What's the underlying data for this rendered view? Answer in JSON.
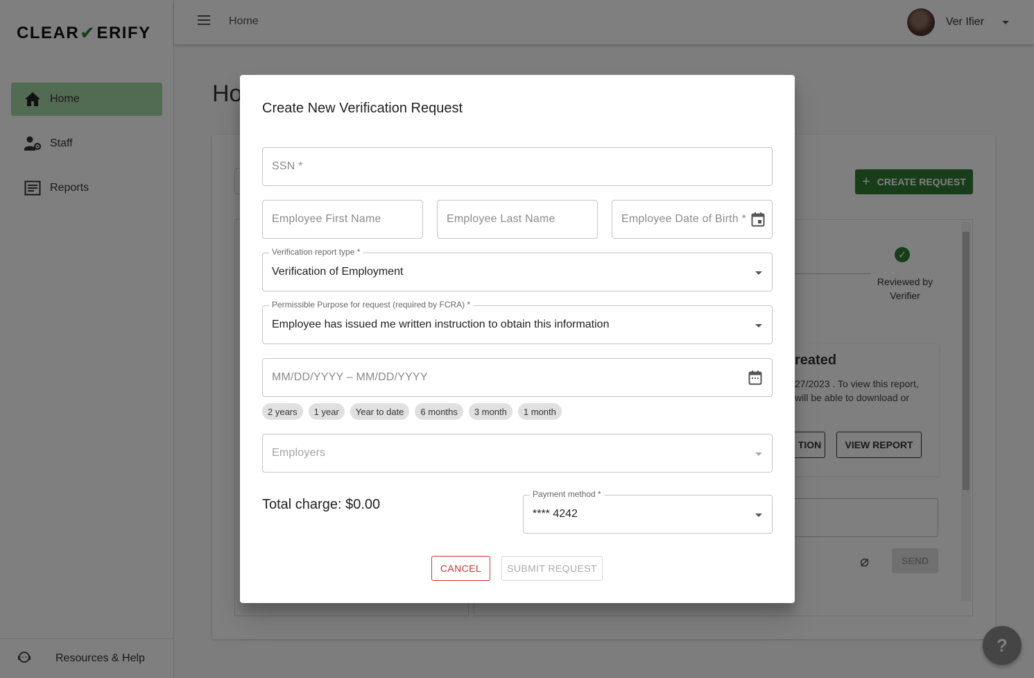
{
  "app": {
    "logo": {
      "part1": "CLEAR",
      "part2": "ERIFY"
    },
    "topbar": {
      "title": "Home",
      "user_name": "Ver Ifier"
    }
  },
  "sidebar": {
    "items": [
      {
        "label": "Home",
        "icon": "home-icon",
        "active": true
      },
      {
        "label": "Staff",
        "icon": "staff-settings-icon",
        "active": false
      },
      {
        "label": "Reports",
        "icon": "reports-icon",
        "active": false
      }
    ],
    "footer_label": "Resources & Help"
  },
  "background": {
    "page_title": "Ho",
    "create_request_label": "CREATE REQUEST",
    "step_label": "Reviewed by Verifier",
    "card_title": "reated",
    "card_text": "27/2023 . To view this report, will be able to download or",
    "action_button_label": "TION",
    "view_report_label": "VIEW REPORT",
    "send_label": "SEND"
  },
  "dialog": {
    "title": "Create New Verification Request",
    "ssn_placeholder": "SSN *",
    "first_name_placeholder": "Employee First Name",
    "last_name_placeholder": "Employee Last Name",
    "dob_placeholder": "Employee Date of Birth *",
    "report_type": {
      "label": "Verification report type *",
      "value": "Verification of Employment"
    },
    "purpose": {
      "label": "Permissible Purpose for request (required by FCRA) *",
      "value": "Employee has issued me written instruction to obtain this information"
    },
    "date_range_placeholder": "MM/DD/YYYY – MM/DD/YYYY",
    "range_chips": [
      "2 years",
      "1 year",
      "Year to date",
      "6 months",
      "3 month",
      "1 month"
    ],
    "employers_placeholder": "Employers",
    "total_charge": "Total charge: $0.00",
    "payment": {
      "label": "Payment method *",
      "value": "**** 4242"
    },
    "cancel_label": "CANCEL",
    "submit_label": "SUBMIT REQUEST"
  },
  "colors": {
    "brand_green": "#2e7d32",
    "active_nav": "#a5d6a7",
    "cancel_red": "#d32f2f"
  }
}
